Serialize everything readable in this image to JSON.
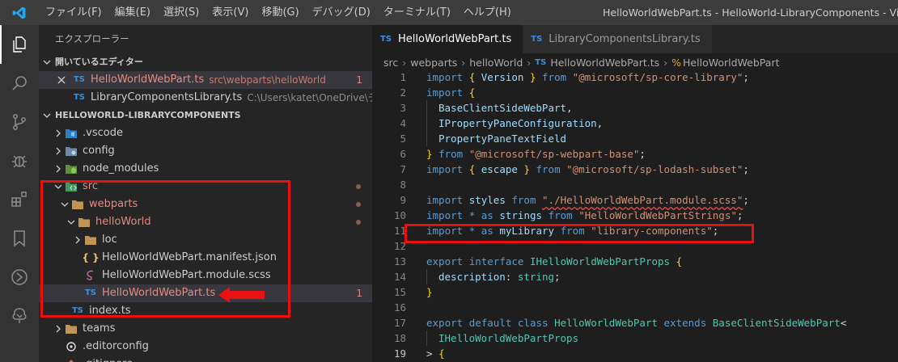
{
  "titlebar": {
    "menu": [
      "ファイル(F)",
      "編集(E)",
      "選択(S)",
      "表示(V)",
      "移動(G)",
      "デバッグ(D)",
      "ターミナル(T)",
      "ヘルプ(H)"
    ],
    "window_title": "HelloWorldWebPart.ts - HelloWorld-LibraryComponents - Visual Studio Code"
  },
  "activitybar": {
    "icons": [
      "explorer-icon",
      "search-icon",
      "source-control-icon",
      "debug-icon",
      "extensions-icon",
      "bookmarks-icon",
      "remote-icon",
      "tree-icon"
    ]
  },
  "sidebar": {
    "title": "エクスプローラー",
    "open_editors": {
      "header": "開いているエディター",
      "items": [
        {
          "name": "HelloWorldWebPart.ts",
          "path": "src\\webparts\\helloWorld",
          "badge": "1"
        },
        {
          "name": "LibraryComponentsLibrary.ts",
          "path": "C:\\Users\\katet\\OneDrive\\デスク..."
        }
      ]
    },
    "project": {
      "header": "HELLOWORLD-LIBRARYCOMPONENTS",
      "tree": [
        {
          "label": ".vscode"
        },
        {
          "label": "config"
        },
        {
          "label": "node_modules"
        },
        {
          "label": "src"
        },
        {
          "label": "webparts"
        },
        {
          "label": "helloWorld"
        },
        {
          "label": "loc"
        },
        {
          "label": "HelloWorldWebPart.manifest.json",
          "icon": "{ }"
        },
        {
          "label": "HelloWorldWebPart.module.scss"
        },
        {
          "label": "HelloWorldWebPart.ts",
          "badge": "1",
          "icon": "TS"
        },
        {
          "label": "index.ts",
          "icon": "TS"
        },
        {
          "label": "teams"
        },
        {
          "label": ".editorconfig"
        },
        {
          "label": ".gitignore"
        }
      ]
    }
  },
  "editor": {
    "tabs": [
      {
        "label": "HelloWorldWebPart.ts",
        "icon": "TS"
      },
      {
        "label": "LibraryComponentsLibrary.ts",
        "icon": "TS"
      }
    ],
    "breadcrumb": [
      "src",
      "webparts",
      "helloWorld",
      "HelloWorldWebPart.ts",
      "HelloWorldWebPart"
    ],
    "lines": [
      {
        "n": "1",
        "t": "import { Version } from \"@microsoft/sp-core-library\";"
      },
      {
        "n": "2",
        "t": "import {"
      },
      {
        "n": "3",
        "t": "  BaseClientSideWebPart,"
      },
      {
        "n": "4",
        "t": "  IPropertyPaneConfiguration,"
      },
      {
        "n": "5",
        "t": "  PropertyPaneTextField"
      },
      {
        "n": "6",
        "t": "} from \"@microsoft/sp-webpart-base\";"
      },
      {
        "n": "7",
        "t": "import { escape } from \"@microsoft/sp-lodash-subset\";"
      },
      {
        "n": "8",
        "t": ""
      },
      {
        "n": "9",
        "t": "import styles from \"./HelloWorldWebPart.module.scss\";"
      },
      {
        "n": "10",
        "t": "import * as strings from \"HelloWorldWebPartStrings\";"
      },
      {
        "n": "11",
        "t": "import * as myLibrary from \"library-components\";"
      },
      {
        "n": "12",
        "t": ""
      },
      {
        "n": "13",
        "t": "export interface IHelloWorldWebPartProps {"
      },
      {
        "n": "14",
        "t": "  description: string;"
      },
      {
        "n": "15",
        "t": "}"
      },
      {
        "n": "16",
        "t": ""
      },
      {
        "n": "17",
        "t": "export default class HelloWorldWebPart extends BaseClientSideWebPart<"
      },
      {
        "n": "18",
        "t": "  IHelloWorldWebPartProps"
      },
      {
        "n": "19",
        "t": "> {"
      }
    ]
  },
  "colors": {
    "annotation_red": "#e8110f",
    "ts_blue": "#3d8fdc",
    "error_red": "#e68a82",
    "folder_brown": "#c09553"
  }
}
